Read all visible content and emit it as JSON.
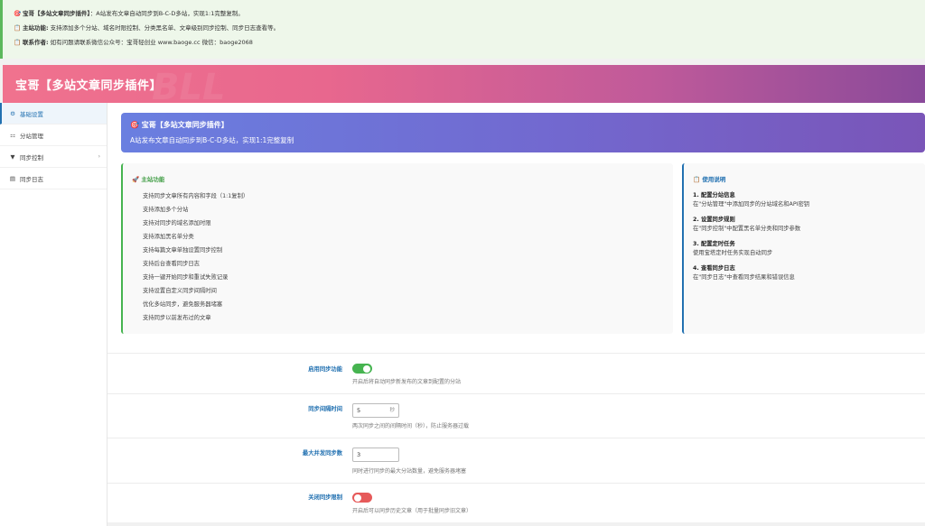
{
  "notice": {
    "line1": {
      "icon": "🎯",
      "bold": "宝哥【多站文章同步插件】",
      "text": "：A站发布文章自动同步到B-C-D多站，实现1:1完整复制。"
    },
    "line2": {
      "icon": "📋",
      "bold": "主站功能:",
      "text": " 支持添加多个分站、域名时限控制、分类黑名单、文章级别同步控制、同步日志查看等。"
    },
    "line3": {
      "icon": "📋",
      "bold": "联系作者:",
      "text": " 如有问题请联系微信公众号：宝哥轻创业 www.baoge.cc 微信：baoge2068"
    }
  },
  "header": {
    "title": "宝哥【多站文章同步插件】",
    "watermark": "BLL"
  },
  "sidebar": {
    "items": [
      {
        "icon": "gear-icon",
        "glyph": "⚙",
        "label": "基础设置"
      },
      {
        "icon": "sitemap-icon",
        "glyph": "⚏",
        "label": "分站管理"
      },
      {
        "icon": "filter-icon",
        "glyph": "▼",
        "label": "同步控制",
        "chevron": "›"
      },
      {
        "icon": "list-icon",
        "glyph": "▤",
        "label": "同步日志"
      }
    ]
  },
  "banner": {
    "icon": "🎯",
    "title": "宝哥【多站文章同步插件】",
    "subtitle": "A站发布文章自动同步到B-C-D多站，实现1:1完整复制"
  },
  "main_features": {
    "icon": "🚀",
    "title": "主站功能",
    "items": [
      "支持同步文章所有内容和字段（1:1复制）",
      "支持添加多个分站",
      "支持对同步的域名添加时限",
      "支持添加黑名单分类",
      "支持每篇文章单独设置同步控制",
      "支持后台查看同步日志",
      "支持一键开始同步和重试失败记录",
      "支持设置自定义同步间隔时间",
      "优化多站同步，避免服务器堵塞",
      "支持同步以前发布过的文章"
    ]
  },
  "usage": {
    "icon": "📋",
    "title": "使用说明",
    "steps": [
      {
        "title": "1. 配置分站信息",
        "desc": "在\"分站管理\"中添加同步的分站域名和API密钥"
      },
      {
        "title": "2. 设置同步规则",
        "desc": "在\"同步控制\"中配置黑名单分类和同步参数"
      },
      {
        "title": "3. 配置定时任务",
        "desc": "使用宝塔定时任务实现自动同步"
      },
      {
        "title": "4. 查看同步日志",
        "desc": "在\"同步日志\"中查看同步结果和错误信息"
      }
    ]
  },
  "settings": {
    "enable_sync": {
      "label": "启用同步功能",
      "state": "on",
      "help": "开启后将自动同步新发布的文章到配置的分站"
    },
    "sync_interval": {
      "label": "同步间隔时间",
      "value": "5",
      "unit": "秒",
      "help": "两次同步之间的间隔时间（秒），防止服务器过载"
    },
    "max_concurrent": {
      "label": "最大并发同步数",
      "value": "3",
      "help": "同时进行同步的最大分站数量，避免服务器堵塞"
    },
    "disable_limit": {
      "label": "关闭同步限制",
      "state": "off",
      "help": "开启后可以同步历史文章（用于批量同步旧文章）"
    }
  },
  "colors": {
    "accent": "#2271b1",
    "success": "#46b450",
    "danger": "#e65a5a",
    "header_start": "#f0728e",
    "header_end": "#8a4a9a"
  }
}
